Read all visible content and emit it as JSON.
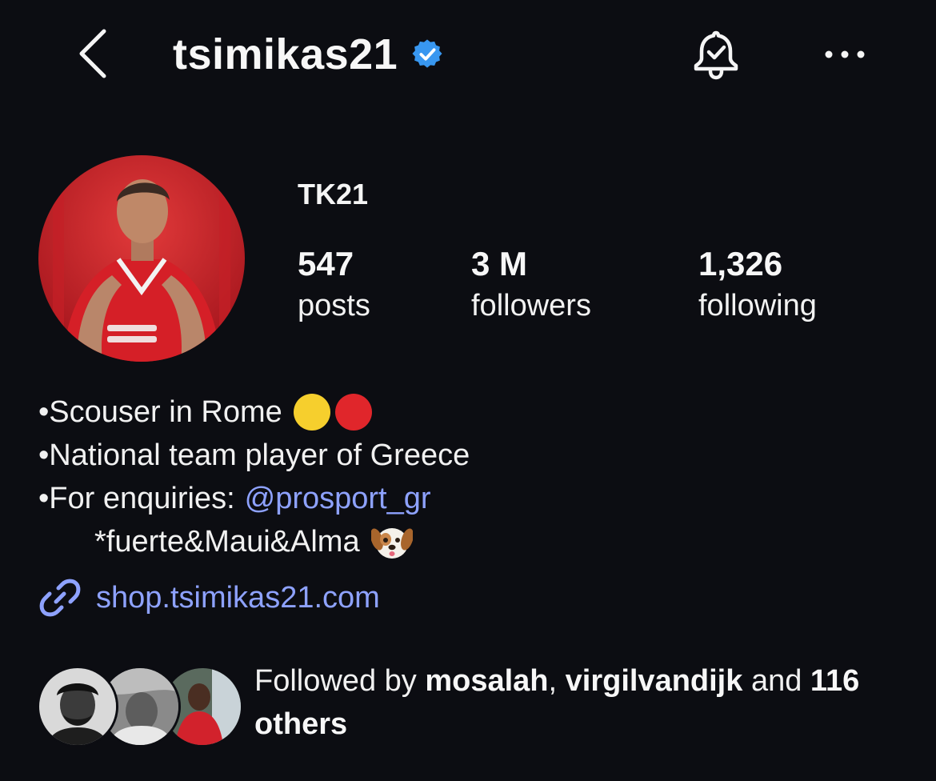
{
  "header": {
    "username": "tsimikas21",
    "verified": true,
    "icons": {
      "back": "chevron-left-icon",
      "verified": "verified-badge-icon",
      "notifications": "bell-check-icon",
      "more": "more-dots-icon"
    }
  },
  "profile": {
    "display_name": "TK21",
    "stats": {
      "posts": {
        "value": "547",
        "label": "posts"
      },
      "followers": {
        "value": "3 M",
        "label": "followers"
      },
      "following": {
        "value": "1,326",
        "label": "following"
      }
    }
  },
  "bio": {
    "line1": "•Scouser in Rome",
    "line2": "•National team player of Greece",
    "line3_prefix": "•For enquiries:",
    "line3_mention": "@prosport_gr",
    "line4": "*fuerte&Maui&Alma",
    "emoji_colors": {
      "yellow": "#f6cf2d",
      "red": "#e0262b"
    }
  },
  "link": {
    "text": "shop.tsimikas21.com",
    "icon": "link-icon"
  },
  "followed_by": {
    "prefix": "Followed by",
    "user1": "mosalah",
    "separator": ",",
    "user2": "virgilvandijk",
    "conjunction": "and",
    "others": "116 others"
  },
  "colors": {
    "background": "#0c0d12",
    "accent_link": "#8ea2ff",
    "verified_blue": "#3897f0",
    "text": "#f5f5f5"
  }
}
